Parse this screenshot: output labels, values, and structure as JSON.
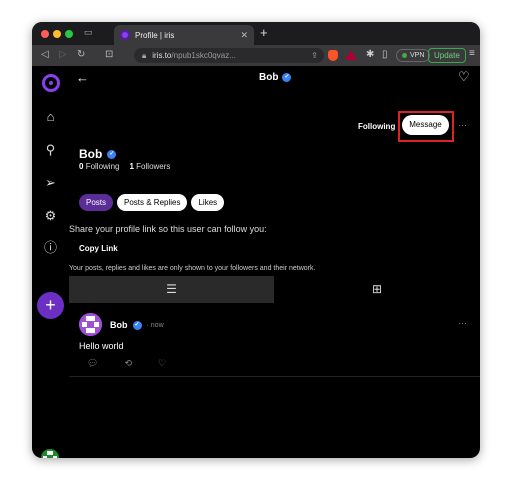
{
  "browser": {
    "tab_title": "Profile | iris",
    "url_host": "iris.to",
    "url_path": "/npub1skc0qvaz...",
    "vpn_label": "VPN",
    "update_label": "Update"
  },
  "header": {
    "title": "Bob"
  },
  "profile": {
    "name": "Bob",
    "following_count": "0",
    "following_label": "Following",
    "followers_count": "1",
    "followers_label": "Followers",
    "following_status": "Following",
    "message_label": "Message"
  },
  "tabs": [
    {
      "label": "Posts",
      "active": true
    },
    {
      "label": "Posts & Replies",
      "active": false
    },
    {
      "label": "Likes",
      "active": false
    }
  ],
  "share": {
    "text": "Share your profile link so this user can follow you:",
    "copy_label": "Copy Link",
    "notice": "Your posts, replies and likes are only shown to your followers and their network."
  },
  "post": {
    "author": "Bob",
    "time": "now",
    "text": "Hello world"
  },
  "colors": {
    "accent": "#6b2fc4",
    "verified": "#3b82f6",
    "highlight": "#dd2222"
  }
}
